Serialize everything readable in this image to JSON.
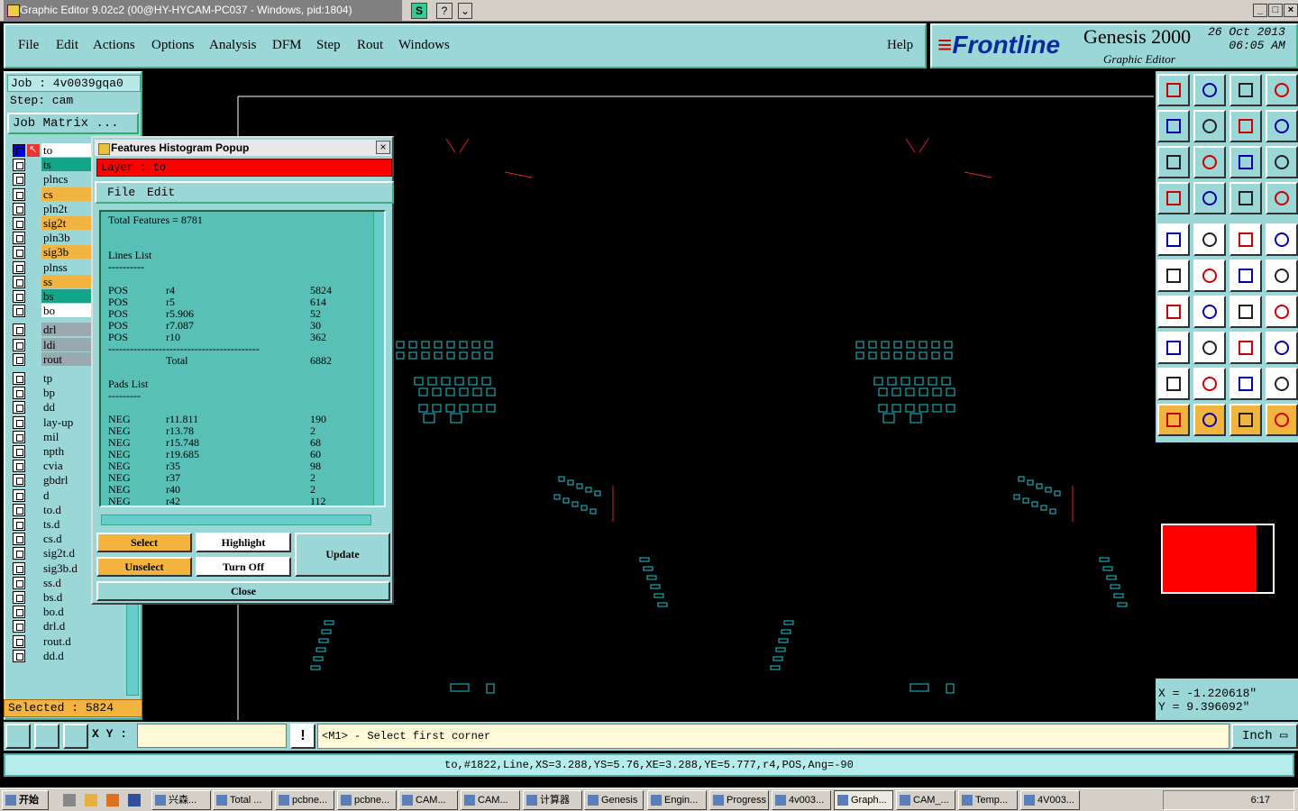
{
  "window": {
    "title": "Graphic Editor 9.02c2 (00@HY-HYCAM-PC037 - Windows, pid:1804)",
    "mini_buttons": [
      "S",
      "?",
      "⌄"
    ],
    "controls": [
      "_",
      "□",
      "×"
    ]
  },
  "menu": {
    "items": [
      "File",
      "Edit",
      "Actions",
      "Options",
      "Analysis",
      "DFM",
      "Step",
      "Rout",
      "Windows"
    ],
    "help": "Help"
  },
  "logo": {
    "brand": "Frontline",
    "product": "Genesis 2000",
    "subtitle": "Graphic Editor",
    "date": "26 Oct 2013",
    "time": "06:05 AM"
  },
  "job": {
    "job_label": "Job  : 4v0039gqa0",
    "step_label": "Step: cam",
    "matrix_button": "Job Matrix ..."
  },
  "layers": [
    {
      "name": "to",
      "color": "#ffffff"
    },
    {
      "name": "ts",
      "color": "#12a588"
    },
    {
      "name": "plncs",
      "color": "#9cd7d8"
    },
    {
      "name": "cs",
      "color": "#f2b33f"
    },
    {
      "name": "pln2t",
      "color": "#9cd7d8"
    },
    {
      "name": "sig2t",
      "color": "#f2b33f"
    },
    {
      "name": "pln3b",
      "color": "#9cd7d8"
    },
    {
      "name": "sig3b",
      "color": "#f2b33f"
    },
    {
      "name": "plnss",
      "color": "#9cd7d8"
    },
    {
      "name": "ss",
      "color": "#f2b33f"
    },
    {
      "name": "bs",
      "color": "#12a588"
    },
    {
      "name": "bo",
      "color": "#ffffff"
    },
    {
      "name": "drl",
      "color": "#9aa8b0"
    },
    {
      "name": "ldi",
      "color": "#9aa8b0"
    },
    {
      "name": "rout",
      "color": "#9aa8b0"
    },
    {
      "name": "tp",
      "color": "#9cd7d8"
    },
    {
      "name": "bp",
      "color": "#9cd7d8"
    },
    {
      "name": "dd",
      "color": "#9cd7d8"
    },
    {
      "name": "lay-up",
      "color": "#9cd7d8"
    },
    {
      "name": "mil",
      "color": "#9cd7d8"
    },
    {
      "name": "npth",
      "color": "#9cd7d8"
    },
    {
      "name": "cvia",
      "color": "#9cd7d8"
    },
    {
      "name": "gbdrl",
      "color": "#9cd7d8"
    },
    {
      "name": "d",
      "color": "#9cd7d8"
    },
    {
      "name": "to.d",
      "color": "#9cd7d8"
    },
    {
      "name": "ts.d",
      "color": "#9cd7d8"
    },
    {
      "name": "cs.d",
      "color": "#9cd7d8"
    },
    {
      "name": "sig2t.d",
      "color": "#9cd7d8"
    },
    {
      "name": "sig3b.d",
      "color": "#9cd7d8"
    },
    {
      "name": "ss.d",
      "color": "#9cd7d8"
    },
    {
      "name": "bs.d",
      "color": "#9cd7d8"
    },
    {
      "name": "bo.d",
      "color": "#9cd7d8"
    },
    {
      "name": "drl.d",
      "color": "#9cd7d8"
    },
    {
      "name": "rout.d",
      "color": "#9cd7d8"
    },
    {
      "name": "dd.d",
      "color": "#9cd7d8"
    }
  ],
  "selected": "Selected : 5824",
  "popup": {
    "title": "Features Histogram Popup",
    "layer": "Layer :  to",
    "menu": [
      "File",
      "Edit"
    ],
    "total": "Total Features = 8781",
    "lines_header": "Lines List",
    "lines": [
      {
        "pol": "POS",
        "sym": "r4",
        "count": "5824"
      },
      {
        "pol": "POS",
        "sym": "r5",
        "count": "614"
      },
      {
        "pol": "POS",
        "sym": "r5.906",
        "count": "52"
      },
      {
        "pol": "POS",
        "sym": "r7.087",
        "count": "30"
      },
      {
        "pol": "POS",
        "sym": "r10",
        "count": "362"
      }
    ],
    "lines_total_label": "Total",
    "lines_total": "6882",
    "pads_header": "Pads List",
    "pads": [
      {
        "pol": "NEG",
        "sym": "r11.811",
        "count": "190"
      },
      {
        "pol": "NEG",
        "sym": "r13.78",
        "count": "2"
      },
      {
        "pol": "NEG",
        "sym": "r15.748",
        "count": "68"
      },
      {
        "pol": "NEG",
        "sym": "r19.685",
        "count": "60"
      },
      {
        "pol": "NEG",
        "sym": "r35",
        "count": "98"
      },
      {
        "pol": "NEG",
        "sym": "r37",
        "count": "2"
      },
      {
        "pol": "NEG",
        "sym": "r40",
        "count": "2"
      },
      {
        "pol": "NEG",
        "sym": "r42",
        "count": "112"
      }
    ],
    "buttons": {
      "select": "Select",
      "unselect": "Unselect",
      "highlight": "Highlight",
      "turn_off": "Turn Off",
      "update": "Update",
      "close": "Close"
    }
  },
  "coords": {
    "x": "X  =  -1.220618\"",
    "y": "Y  =  9.396092\""
  },
  "status": {
    "xy_label": "X Y :",
    "xy_value": "",
    "prompt": "<M1> - Select first corner",
    "units": "Inch",
    "info": "to,#1822,Line,XS=3.288,YS=5.76,XE=3.288,YE=5.777,r4,POS,Ang=-90"
  },
  "taskbar": {
    "start": "开始",
    "tasks": [
      "兴森...",
      "Total ...",
      "pcbne...",
      "pcbne...",
      "CAM...",
      "CAM...",
      "计算器",
      "Genesis",
      "Engin...",
      "Progress",
      "4v003...",
      "Graph...",
      "CAM_...",
      "Temp...",
      "4V003..."
    ],
    "clock": "6:17"
  },
  "colors": {
    "panel": "#9cd7d8",
    "cyan_trace": "#1fc8d2",
    "red_trace": "#e0202a",
    "selected_orange": "#f2b33f",
    "layer_red": "#ff0000"
  }
}
